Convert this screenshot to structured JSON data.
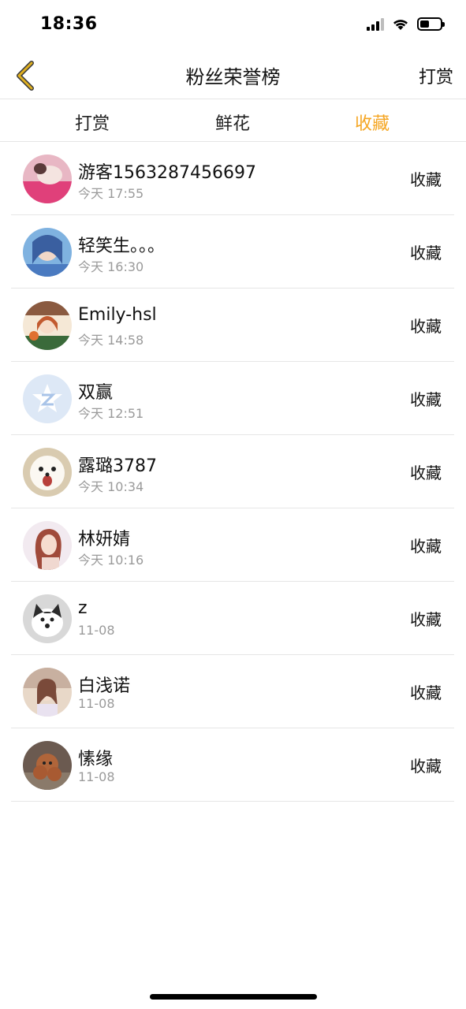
{
  "status_bar": {
    "time": "18:36",
    "battery_level": 0.45
  },
  "nav": {
    "title": "粉丝荣誉榜",
    "right_label": "打赏",
    "back_icon": "chevron-left-icon",
    "back_color": "#e0b020"
  },
  "tabs": [
    {
      "label": "打赏",
      "active": false
    },
    {
      "label": "鲜花",
      "active": false
    },
    {
      "label": "收藏",
      "active": true
    }
  ],
  "colors": {
    "accent": "#f5a623",
    "divider": "#e6e6e6",
    "secondary_text": "#9a9a9a"
  },
  "fans": [
    {
      "name": "游客1563287456697",
      "time": "今天 17:55",
      "action": "收藏",
      "avatar": "pink-blanket-photo"
    },
    {
      "name": "轻笑生。。。",
      "time": "今天 16:30",
      "action": "收藏",
      "avatar": "anime-girl-blue"
    },
    {
      "name": "Emily-hsl",
      "time": "今天 14:58",
      "action": "收藏",
      "avatar": "anime-girl-room"
    },
    {
      "name": "双赢",
      "time": "今天 12:51",
      "action": "收藏",
      "avatar": "qzone-star-logo"
    },
    {
      "name": "露璐3787",
      "time": "今天 10:34",
      "action": "收藏",
      "avatar": "white-dog"
    },
    {
      "name": "林妍婧",
      "time": "今天 10:16",
      "action": "收藏",
      "avatar": "woman-portrait"
    },
    {
      "name": "z",
      "time": "11-08",
      "action": "收藏",
      "avatar": "husky-dog"
    },
    {
      "name": "白浅诺",
      "time": "11-08",
      "action": "收藏",
      "avatar": "girl-outdoor"
    },
    {
      "name": "愫缘",
      "time": "11-08",
      "action": "收藏",
      "avatar": "brown-poodle"
    }
  ]
}
